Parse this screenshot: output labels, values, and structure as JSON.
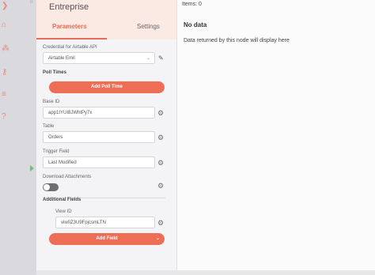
{
  "panel": {
    "title": "Entreprise",
    "tabs": [
      "Parameters",
      "Settings"
    ]
  },
  "params": {
    "credential_label": "Credential for Airtable API",
    "credential_value": "Airtable Emil",
    "poll_times_label": "Poll Times",
    "add_poll_time": "Add Poll Time",
    "base_id_label": "Base ID",
    "base_id_value": "app1tYUI8JWhtPy7x",
    "table_label": "Table",
    "table_value": "Orders",
    "trigger_field_label": "Trigger Field",
    "trigger_field_value": "Last Modified",
    "download_attachments_label": "Download Attachments",
    "additional_fields_label": "Additional Fields",
    "view_id_label": "View ID",
    "view_id_value": "viw0Z3U9FpjcsmLTN",
    "add_field": "Add Field",
    "download_attachments_on": false
  },
  "output": {
    "items_label": "Items: 0",
    "no_data": "No data",
    "description": "Data returned by this node will display here"
  },
  "colors": {
    "accent": "#ee6d55",
    "tab_active": "#e36e56",
    "header_bg": "#fbe9e4"
  }
}
